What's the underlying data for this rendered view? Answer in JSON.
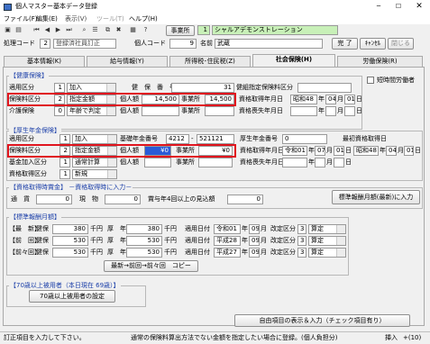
{
  "window": {
    "title": "個人マスター基本データ登録"
  },
  "menu": [
    "ファイル(F)",
    "編集(E)",
    "表示(V)",
    "ツール(T)",
    "ヘルプ(H)"
  ],
  "toolbar": {
    "office_btn": "事業所",
    "office_code": "1",
    "office_name": "シャルアデモンストレーション"
  },
  "header": {
    "proc_code_label": "処理コード",
    "proc_code": "2",
    "proc_name": "登録済社員訂正",
    "person_code_label": "個人コード",
    "person_code": "9",
    "name_label": "名前",
    "name_value": "武蔵",
    "complete_btn": "完 了",
    "cancel_btn": "ｷｬﾝｾﾙ",
    "close_btn": "閉じる"
  },
  "tabs": [
    "基本情報(K)",
    "給与情報(Y)",
    "所得税･住民税(Z)",
    "社会保険(H)",
    "労働保険(R)"
  ],
  "health": {
    "title": "【健康保険】",
    "rows": [
      {
        "label": "適用区分",
        "code": "1",
        "sel": "加入",
        "mid_label": "健　保　番　号",
        "mid_val": "31",
        "right_label": "健組指定保険料区分",
        "right_val": ""
      },
      {
        "label": "保険料区分",
        "code": "2",
        "sel": "指定金額",
        "indiv_label": "個人額",
        "indiv_val": "14,500",
        "office_label": "事業所",
        "office_val": "14,500",
        "right_label": "資格取得年月日",
        "era": "昭和48",
        "month": "04",
        "day": "01",
        "unit_y": "年",
        "unit_m": "月",
        "unit_d": "日"
      },
      {
        "label": "介護保険",
        "code": "0",
        "sel": "年齢で判定",
        "indiv_label": "個人額",
        "indiv_val": "",
        "office_label": "事業所",
        "office_val": "",
        "right_label": "資格喪失年月日",
        "unit_y": "年",
        "unit_m": "月",
        "unit_d": "日"
      }
    ],
    "short_time_label": "短時間労働者"
  },
  "pension": {
    "title": "【厚生年金保険】",
    "rows": [
      {
        "label": "適用区分",
        "code": "1",
        "sel": "加入",
        "base_label": "基礎年金番号",
        "base1": "4212",
        "base2": "521121",
        "pnum_label": "厚生年金番号",
        "pnum_val": "0",
        "first_label": "最初資格取得日"
      },
      {
        "label": "保険料区分",
        "code": "2",
        "sel": "指定金額",
        "indiv_label": "個人額",
        "indiv_val": "¥0",
        "office_label": "事業所",
        "office_val": "¥0",
        "right_label": "資格取得年月日",
        "era": "令和01",
        "month": "07",
        "day": "01",
        "unit_y": "年",
        "unit_m": "月",
        "unit_d": "日",
        "first_era": "昭和48",
        "first_month": "04",
        "first_day": "01"
      },
      {
        "label": "基金加入区分",
        "code": "1",
        "sel": "通常計算",
        "indiv_label": "個人額",
        "office_label": "事業所",
        "right_label": "資格喪失年月日",
        "unit_y": "年",
        "unit_m": "月",
        "unit_d": "日"
      },
      {
        "label": "資格取得区分",
        "code": "1",
        "sel": "新規"
      }
    ]
  },
  "bonus": {
    "title": "【資格取得時賞金】 －資格取得時に入力－",
    "cash_label": "通　貨",
    "cash_val": "0",
    "kind_label": "現　物",
    "kind_val": "0",
    "est_label": "賞与年4回以上の見込額",
    "est_val": "0",
    "btn": "標準報酬月額(最新)に入力"
  },
  "standard": {
    "title": "【標準報酬月額】",
    "unit": "千円",
    "rows": [
      {
        "label": "【最　新】",
        "h_label": "健保",
        "h_val": "380",
        "p_label": "厚　年",
        "p_val": "380",
        "date_label": "適用日付",
        "era": "令和01",
        "month": "09",
        "reason_label": "改定区分",
        "reason_code": "3",
        "reason": "算定"
      },
      {
        "label": "【前　回】",
        "h_label": "健保",
        "h_val": "530",
        "p_label": "厚　年",
        "p_val": "530",
        "date_label": "適用日付",
        "era": "平成28",
        "month": "09",
        "reason_label": "改定区分",
        "reason_code": "3",
        "reason": "算定"
      },
      {
        "label": "【前々回】",
        "h_label": "健保",
        "h_val": "530",
        "p_label": "厚　年",
        "p_val": "530",
        "date_label": "適用日付",
        "era": "平成27",
        "month": "09",
        "reason_label": "改定区分",
        "reason_code": "3",
        "reason": "算定"
      }
    ],
    "unit_y": "年",
    "unit_m": "月",
    "copy_btn": "最新→前回→前々回　コピー"
  },
  "over70": {
    "title": "【70歳以上被用者（本日現在 69歳）】",
    "btn": "70歳以上被用者の設定"
  },
  "free_btn": "自由項目の表示＆入力（チェック項目有り）",
  "status": {
    "main": "訂正項目を入力して下さい。",
    "msg": "通常の保険料算出方法でない金額を指定したい場合に登録。(個人負担分)",
    "ins": "挿入",
    "count": "+(10)"
  }
}
